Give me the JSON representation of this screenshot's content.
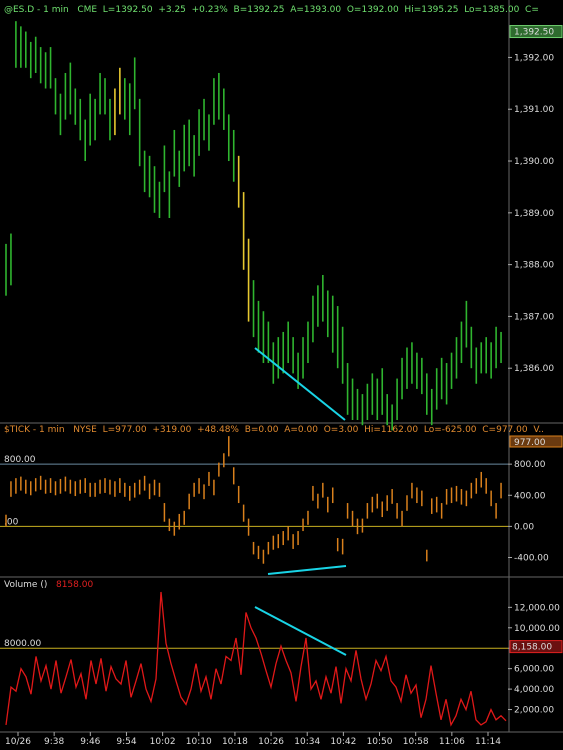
{
  "price_header": {
    "symbol": "@ES.D - 1 min",
    "exchange": "CME",
    "last": "L=1392.50",
    "change": "+3.25",
    "change_pct": "+0.23%",
    "bid": "B=1392.25",
    "ask": "A=1393.00",
    "open": "O=1392.00",
    "high": "Hi=1395.25",
    "low": "Lo=1385.00",
    "close": "C=",
    "last_badge": "1,392.50"
  },
  "tick_header": {
    "symbol": "$TICK - 1 min",
    "exchange": "NYSE",
    "last": "L=977.00",
    "change": "+319.00",
    "change_pct": "+48.48%",
    "bid": "B=0.00",
    "ask": "A=0.00",
    "open": "O=3.00",
    "high": "Hi=1162.00",
    "low": "Lo=-625.00",
    "close": "C=977.00",
    "more": "V..",
    "last_badge": "977.00",
    "level_high": "800.00",
    "level_zero": ".00"
  },
  "volume_header": {
    "title": "Volume",
    "parens": "()",
    "value": "8158.00",
    "level": "8000.00",
    "last_badge": "8,158.00"
  },
  "colors": {
    "up_bar": "#2fb52f",
    "highlight_bar": "#e6c830",
    "tick_bar": "#d9801c",
    "volume_line": "#e01818",
    "trend_line": "#19d4e6",
    "level_line": "#c8b020",
    "level_line_blue": "#6a8aa0"
  },
  "time_axis": [
    "10/26",
    "9:38",
    "9:46",
    "9:54",
    "10:02",
    "10:10",
    "10:18",
    "10:26",
    "10:34",
    "10:42",
    "10:50",
    "10:58",
    "11:06",
    "11:14"
  ],
  "chart_data": [
    {
      "type": "ohlc",
      "name": "price",
      "y_ticks": [
        "1,392.00",
        "1,391.00",
        "1,390.00",
        "1,389.00",
        "1,388.00",
        "1,387.00",
        "1,386.00"
      ],
      "ylim": [
        1385.0,
        1392.8
      ],
      "highs": [
        1388.4,
        1388.6,
        1392.7,
        1392.6,
        1392.5,
        1392.3,
        1392.4,
        1392.2,
        1392.1,
        1392.2,
        1391.6,
        1391.3,
        1391.7,
        1391.9,
        1391.4,
        1391.2,
        1390.8,
        1391.3,
        1391.2,
        1391.7,
        1391.6,
        1391.2,
        1391.4,
        1391.8,
        1391.6,
        1391.5,
        1392.0,
        1391.2,
        1390.2,
        1390.1,
        1389.9,
        1389.6,
        1390.3,
        1389.8,
        1390.6,
        1390.2,
        1390.7,
        1390.8,
        1390.5,
        1391.0,
        1391.2,
        1390.9,
        1391.6,
        1391.7,
        1391.4,
        1390.9,
        1390.6,
        1390.1,
        1389.4,
        1388.5,
        1387.7,
        1387.3,
        1387.1,
        1386.9,
        1386.5,
        1386.6,
        1386.7,
        1386.9,
        1386.6,
        1386.3,
        1386.6,
        1386.9,
        1387.4,
        1387.6,
        1387.8,
        1387.5,
        1387.4,
        1387.2,
        1386.8,
        1386.1,
        1385.8,
        1385.6,
        1385.5,
        1385.7,
        1385.9,
        1385.8,
        1386.0,
        1385.5,
        1385.3,
        1385.8,
        1386.2,
        1386.4,
        1386.5,
        1386.3,
        1386.2,
        1385.9,
        1385.6,
        1386.0,
        1386.2,
        1386.1,
        1386.3,
        1386.6,
        1386.9,
        1387.3,
        1386.8,
        1386.4,
        1386.5,
        1386.6,
        1386.5,
        1386.8,
        1386.7
      ],
      "lows": [
        1387.4,
        1387.6,
        1391.8,
        1391.8,
        1391.8,
        1391.6,
        1391.7,
        1391.5,
        1391.4,
        1391.4,
        1390.9,
        1390.5,
        1390.8,
        1390.9,
        1390.7,
        1390.4,
        1390.0,
        1390.3,
        1390.4,
        1390.9,
        1390.9,
        1390.4,
        1390.5,
        1390.9,
        1390.8,
        1390.5,
        1391.0,
        1389.9,
        1389.4,
        1389.3,
        1389.0,
        1388.9,
        1389.4,
        1388.9,
        1389.7,
        1389.5,
        1389.8,
        1389.9,
        1389.7,
        1390.1,
        1390.4,
        1390.2,
        1390.7,
        1390.8,
        1390.6,
        1390.0,
        1389.6,
        1389.1,
        1387.9,
        1386.9,
        1386.6,
        1386.3,
        1386.1,
        1386.1,
        1385.7,
        1385.8,
        1385.9,
        1386.1,
        1385.9,
        1385.6,
        1385.8,
        1386.1,
        1386.5,
        1386.8,
        1386.9,
        1386.6,
        1386.3,
        1386.0,
        1385.7,
        1385.1,
        1385.0,
        1385.0,
        1384.9,
        1385.0,
        1385.1,
        1385.0,
        1385.1,
        1384.9,
        1384.8,
        1385.0,
        1385.4,
        1385.6,
        1385.7,
        1385.6,
        1385.5,
        1385.1,
        1384.9,
        1385.2,
        1385.4,
        1385.3,
        1385.6,
        1385.8,
        1386.1,
        1386.4,
        1386.0,
        1385.7,
        1385.9,
        1385.9,
        1385.8,
        1386.0,
        1386.1
      ],
      "highlight_indices": [
        22,
        23,
        47,
        48,
        49
      ]
    },
    {
      "type": "bar",
      "name": "$TICK",
      "y_ticks": [
        "800.00",
        "400.00",
        "0.00",
        "-400.00"
      ],
      "ylim": [
        -625,
        1162
      ],
      "highs": [
        150,
        580,
        620,
        640,
        600,
        580,
        620,
        650,
        600,
        620,
        580,
        610,
        640,
        600,
        580,
        600,
        620,
        560,
        560,
        600,
        620,
        600,
        580,
        620,
        560,
        520,
        560,
        600,
        650,
        550,
        600,
        560,
        300,
        100,
        60,
        160,
        200,
        420,
        560,
        620,
        540,
        700,
        600,
        820,
        940,
        1160,
        760,
        520,
        280,
        100,
        -200,
        -250,
        -300,
        -200,
        -120,
        -100,
        -60,
        0,
        -100,
        -60,
        100,
        200,
        520,
        420,
        560,
        380,
        500,
        -150,
        -160,
        300,
        200,
        100,
        100,
        300,
        380,
        420,
        320,
        400,
        480,
        300,
        200,
        400,
        560,
        500,
        460,
        -300,
        360,
        380,
        300,
        480,
        500,
        520,
        480,
        460,
        560,
        620,
        700,
        620,
        460,
        300,
        560
      ],
      "lows": [
        0,
        380,
        420,
        460,
        420,
        400,
        450,
        470,
        420,
        430,
        400,
        420,
        450,
        420,
        390,
        420,
        430,
        380,
        380,
        420,
        430,
        410,
        380,
        430,
        380,
        330,
        370,
        410,
        460,
        350,
        400,
        380,
        60,
        -60,
        -120,
        -40,
        20,
        220,
        380,
        420,
        350,
        520,
        400,
        640,
        760,
        900,
        540,
        300,
        60,
        -120,
        -360,
        -420,
        -480,
        -360,
        -300,
        -280,
        -240,
        -180,
        -290,
        -240,
        -60,
        20,
        330,
        230,
        370,
        180,
        300,
        -320,
        -360,
        100,
        0,
        -100,
        -80,
        100,
        180,
        230,
        120,
        200,
        290,
        100,
        0,
        200,
        360,
        300,
        260,
        -450,
        160,
        180,
        100,
        280,
        300,
        320,
        280,
        260,
        360,
        420,
        500,
        420,
        260,
        100,
        360
      ]
    },
    {
      "type": "line",
      "name": "Volume",
      "y_ticks": [
        "12,000.00",
        "10,000.00",
        "8,000.00",
        "6,000.00",
        "4,000.00",
        "2,000.00"
      ],
      "ylim": [
        0,
        13500
      ],
      "values": [
        500,
        4200,
        3800,
        6000,
        5200,
        3500,
        7200,
        4800,
        6300,
        4000,
        6800,
        3600,
        5200,
        6900,
        4200,
        5500,
        3000,
        6800,
        4500,
        7000,
        3800,
        6200,
        5000,
        4500,
        6800,
        3200,
        4800,
        6500,
        4000,
        2800,
        5000,
        13500,
        8500,
        6500,
        4800,
        3200,
        2500,
        4000,
        6500,
        3800,
        5200,
        3000,
        6000,
        4500,
        7200,
        6800,
        9000,
        5400,
        11500,
        10000,
        9000,
        7500,
        5800,
        4200,
        6500,
        8200,
        6800,
        5600,
        2800,
        6200,
        9000,
        4000,
        4800,
        3000,
        5200,
        3600,
        6200,
        2600,
        6000,
        4800,
        7800,
        5000,
        3000,
        4500,
        6800,
        5800,
        7200,
        4800,
        4200,
        2800,
        5400,
        3600,
        4400,
        1200,
        3000,
        6300,
        3600,
        1000,
        3000,
        500,
        1400,
        3000,
        2000,
        3800,
        1000,
        500,
        800,
        2000,
        1000,
        1400,
        900
      ]
    }
  ]
}
